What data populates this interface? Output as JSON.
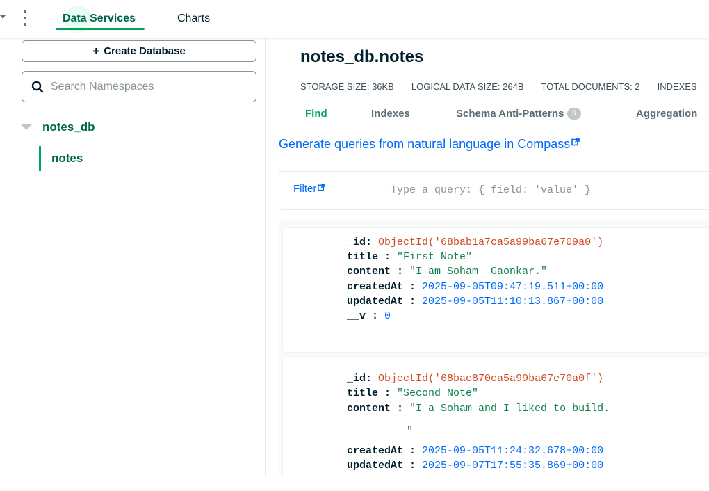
{
  "topnav": {
    "tabs": [
      {
        "label": "Data Services",
        "active": true
      },
      {
        "label": "Charts",
        "active": false
      }
    ]
  },
  "sidebar": {
    "create_database_label": "Create Database",
    "search_placeholder": "Search Namespaces",
    "database": "notes_db",
    "collection": "notes"
  },
  "collection": {
    "title": "notes_db.notes",
    "stats": [
      {
        "label": "STORAGE SIZE:",
        "value": "36KB"
      },
      {
        "label": "LOGICAL DATA SIZE:",
        "value": "264B"
      },
      {
        "label": "TOTAL DOCUMENTS:",
        "value": "2"
      },
      {
        "label": "INDEXES",
        "value": ""
      }
    ],
    "tabs": [
      "Find",
      "Indexes",
      "Schema Anti-Patterns",
      "Aggregation"
    ],
    "anti_patterns_count": "0",
    "nl_link": "Generate queries from natural language in Compass",
    "filter_label": "Filter",
    "filter_placeholder": "Type a query: { field: 'value' }"
  },
  "documents": [
    {
      "id_key": "_id",
      "id_value": "ObjectId('68bab1a7ca5a99ba67e709a0')",
      "title_key": "title",
      "title_value": "\"First Note\"",
      "content_key": "content",
      "content_value": "\"I am Soham  Gaonkar.\"",
      "created_key": "createdAt",
      "created_value": "2025-09-05T09:47:19.511+00:00",
      "updated_key": "updatedAt",
      "updated_value": "2025-09-05T11:10:13.867+00:00",
      "v_key": "__v",
      "v_value": "0"
    },
    {
      "id_key": "_id",
      "id_value": "ObjectId('68bac870ca5a99ba67e70a0f')",
      "title_key": "title",
      "title_value": "\"Second Note\"",
      "content_key": "content",
      "content_value": "\"I a Soham and I liked to build.",
      "content_cont": "\"",
      "created_key": "createdAt",
      "created_value": "2025-09-05T11:24:32.678+00:00",
      "updated_key": "updatedAt",
      "updated_value": "2025-09-07T17:55:35.869+00:00"
    }
  ],
  "colors": {
    "brand_green": "#00684a",
    "accent_green": "#00a35c",
    "link_blue": "#016bf8",
    "objectid_red": "#cf4a22",
    "string_green": "#12824d"
  }
}
